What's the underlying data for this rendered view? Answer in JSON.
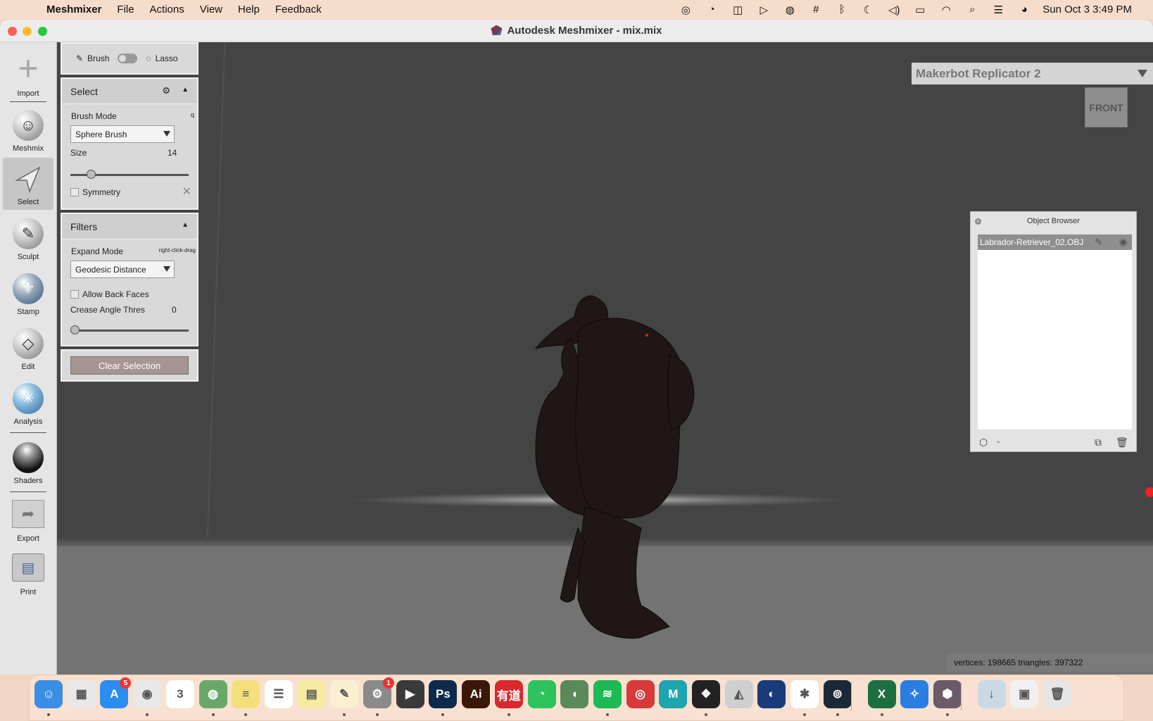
{
  "menubar": {
    "app": "Meshmixer",
    "items": [
      "File",
      "Actions",
      "View",
      "Help",
      "Feedback"
    ],
    "clock": "Sun Oct 3  3:49 PM"
  },
  "window": {
    "title": "Autodesk Meshmixer - mix.mix"
  },
  "toolbar": {
    "items": [
      {
        "label": "Import",
        "icon": "plus-icon"
      },
      {
        "label": "Meshmix",
        "icon": "meshmix-icon"
      },
      {
        "label": "Select",
        "icon": "select-arrow-icon",
        "selected": true
      },
      {
        "label": "Sculpt",
        "icon": "sculpt-brush-icon"
      },
      {
        "label": "Stamp",
        "icon": "stamp-icon"
      },
      {
        "label": "Edit",
        "icon": "edit-icon"
      },
      {
        "label": "Analysis",
        "icon": "analysis-icon"
      },
      {
        "label": "Shaders",
        "icon": "shaders-icon"
      },
      {
        "label": "Export",
        "icon": "export-icon"
      },
      {
        "label": "Print",
        "icon": "print-icon"
      }
    ]
  },
  "select_panel": {
    "toggle": {
      "left": "Brush",
      "right": "Lasso"
    },
    "title": "Select",
    "brush_mode_label": "Brush Mode",
    "brush_mode_hotkey": "q",
    "brush_mode_value": "Sphere Brush",
    "size_label": "Size",
    "size_value": "14",
    "size_level": 0.17,
    "symmetry_label": "Symmetry"
  },
  "filters_panel": {
    "title": "Filters",
    "expand_mode_label": "Expand Mode",
    "expand_mode_hint": "right-click-drag",
    "expand_mode_value": "Geodesic Distance",
    "allow_back_faces_label": "Allow Back Faces",
    "crease_label": "Crease Angle Thres",
    "crease_value": "0",
    "crease_level": 0.0
  },
  "clear_selection": "Clear Selection",
  "viewport": {
    "printer": "Makerbot Replicator 2",
    "view_cube": "FRONT",
    "status": "vertices: 198665  triangles: 397322"
  },
  "object_browser": {
    "title": "Object Browser",
    "items": [
      "Labrador-Retriever_02.OBJ"
    ]
  },
  "dock": {
    "apps": [
      {
        "name": "Finder",
        "color": "#3a8ee6",
        "glyph": "☺"
      },
      {
        "name": "Launchpad",
        "color": "#e8e8e8",
        "glyph": "▦"
      },
      {
        "name": "App Store",
        "color": "#2b8df0",
        "glyph": "A",
        "badge": "5"
      },
      {
        "name": "Chrome",
        "color": "#e8e8e8",
        "glyph": "◉"
      },
      {
        "name": "Calendar",
        "color": "#ffffff",
        "glyph": "3"
      },
      {
        "name": "Network Utility",
        "color": "#6aa86a",
        "glyph": "◍"
      },
      {
        "name": "Stickies",
        "color": "#f3e07a",
        "glyph": "≡"
      },
      {
        "name": "Reminders",
        "color": "#ffffff",
        "glyph": "☰"
      },
      {
        "name": "Notes",
        "color": "#f6e9a0",
        "glyph": "▤"
      },
      {
        "name": "Pages",
        "color": "#f8f0d0",
        "glyph": "✎"
      },
      {
        "name": "System Preferences",
        "color": "#8a8a8a",
        "glyph": "⚙",
        "badge": "1"
      },
      {
        "name": "Final Cut Pro",
        "color": "#3a3a3a",
        "glyph": "▶"
      },
      {
        "name": "Photoshop",
        "color": "#0e2a4a",
        "glyph": "Ps"
      },
      {
        "name": "Illustrator",
        "color": "#3a1808",
        "glyph": "Ai"
      },
      {
        "name": "Youdao",
        "color": "#d8292f",
        "glyph": "有道"
      },
      {
        "name": "WeChat",
        "color": "#2dc35c",
        "glyph": "◔"
      },
      {
        "name": "Vectorworks",
        "color": "#5a8a5a",
        "glyph": "◖"
      },
      {
        "name": "Spotify",
        "color": "#1db954",
        "glyph": "≋"
      },
      {
        "name": "NetEase Music",
        "color": "#d83a3a",
        "glyph": "◎"
      },
      {
        "name": "Maya",
        "color": "#1ea5b0",
        "glyph": "M"
      },
      {
        "name": "Figma",
        "color": "#222222",
        "glyph": "❖"
      },
      {
        "name": "Rhino",
        "color": "#cfcfcf",
        "glyph": "◭"
      },
      {
        "name": "Cinema 4D",
        "color": "#1a3a7a",
        "glyph": "◐"
      },
      {
        "name": "Slack",
        "color": "#ffffff",
        "glyph": "✱"
      },
      {
        "name": "Steam",
        "color": "#1b2838",
        "glyph": "⊚"
      },
      {
        "name": "Excel",
        "color": "#1d6f42",
        "glyph": "X"
      },
      {
        "name": "Safari",
        "color": "#2a7de1",
        "glyph": "✧"
      },
      {
        "name": "Meshmixer",
        "color": "#6a5a6a",
        "glyph": "⬢"
      },
      {
        "name": "Downloads",
        "color": "#c9d9e6",
        "glyph": "↓"
      },
      {
        "name": "Preview",
        "color": "#f0f0f0",
        "glyph": "▣"
      },
      {
        "name": "Trash",
        "color": "#e6e6e6",
        "glyph": "🗑"
      }
    ]
  }
}
